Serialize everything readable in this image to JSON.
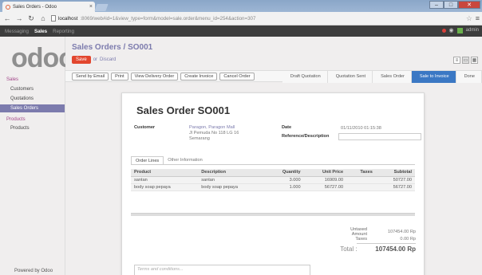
{
  "browser": {
    "tab_title": "Sales Orders - Odoo",
    "url_host": "localhost",
    "url_rest": ":8069/web#id=1&view_type=form&model=sale.order&menu_id=254&action=307"
  },
  "topmenu": {
    "items": [
      "Messaging",
      "Sales",
      "Reporting"
    ],
    "active": "Sales",
    "user": "admin"
  },
  "logo": {
    "text": "odoo"
  },
  "sidebar": {
    "sections": [
      {
        "title": "Sales",
        "items": [
          "Customers",
          "Quotations",
          "Sales Orders"
        ]
      },
      {
        "title": "Products",
        "items": [
          "Products"
        ]
      }
    ],
    "active_item": "Sales Orders",
    "powered_by": "Powered by Odoo"
  },
  "breadcrumb": {
    "parent": "Sales Orders",
    "separator": " / ",
    "current": "SO001"
  },
  "buttons": {
    "save": "Save",
    "discard_prefix": "or",
    "discard": "Discard"
  },
  "actions": [
    "Send by Email",
    "Print",
    "View Delivery Order",
    "Create Invoice",
    "Cancel Order"
  ],
  "statusbar": [
    "Draft Quotation",
    "Quotation Sent",
    "Sales Order",
    "Sale to Invoice",
    "Done"
  ],
  "statusbar_current": "Sale to Invoice",
  "form": {
    "title": "Sales Order SO001",
    "customer_label": "Customer",
    "customer_lines": [
      "Paragon, Paragon Mall",
      "Jl Pemuda No 118 LG 16",
      "Semarang"
    ],
    "date_label": "Date",
    "date_value": "01/11/2010 01:15:38",
    "ref_label": "Reference/Description",
    "ref_value": ""
  },
  "tabs": [
    "Order Lines",
    "Other Information"
  ],
  "table": {
    "headers": [
      "Product",
      "Description",
      "Quantity",
      "Unit Price",
      "Taxes",
      "Subtotal"
    ],
    "rows": [
      [
        "santan",
        "santan",
        "3.000",
        "16909.00",
        "",
        "50727.00"
      ],
      [
        "body soap pepaya",
        "body soap pepaya",
        "1.000",
        "56727.00",
        "",
        "56727.00"
      ]
    ]
  },
  "totals": {
    "untaxed_label": "Untaxed Amount",
    "untaxed": "107454.00 Rp",
    "taxes_label": "Taxes",
    "taxes": "0.00 Rp",
    "total_label": "Total :",
    "total": "107454.00 Rp"
  },
  "terms_placeholder": "Terms and conditions...",
  "colors": {
    "brand": "#a24689",
    "accent": "#7c7bad",
    "save": "#e2462e",
    "status_current": "#3b78c4"
  }
}
